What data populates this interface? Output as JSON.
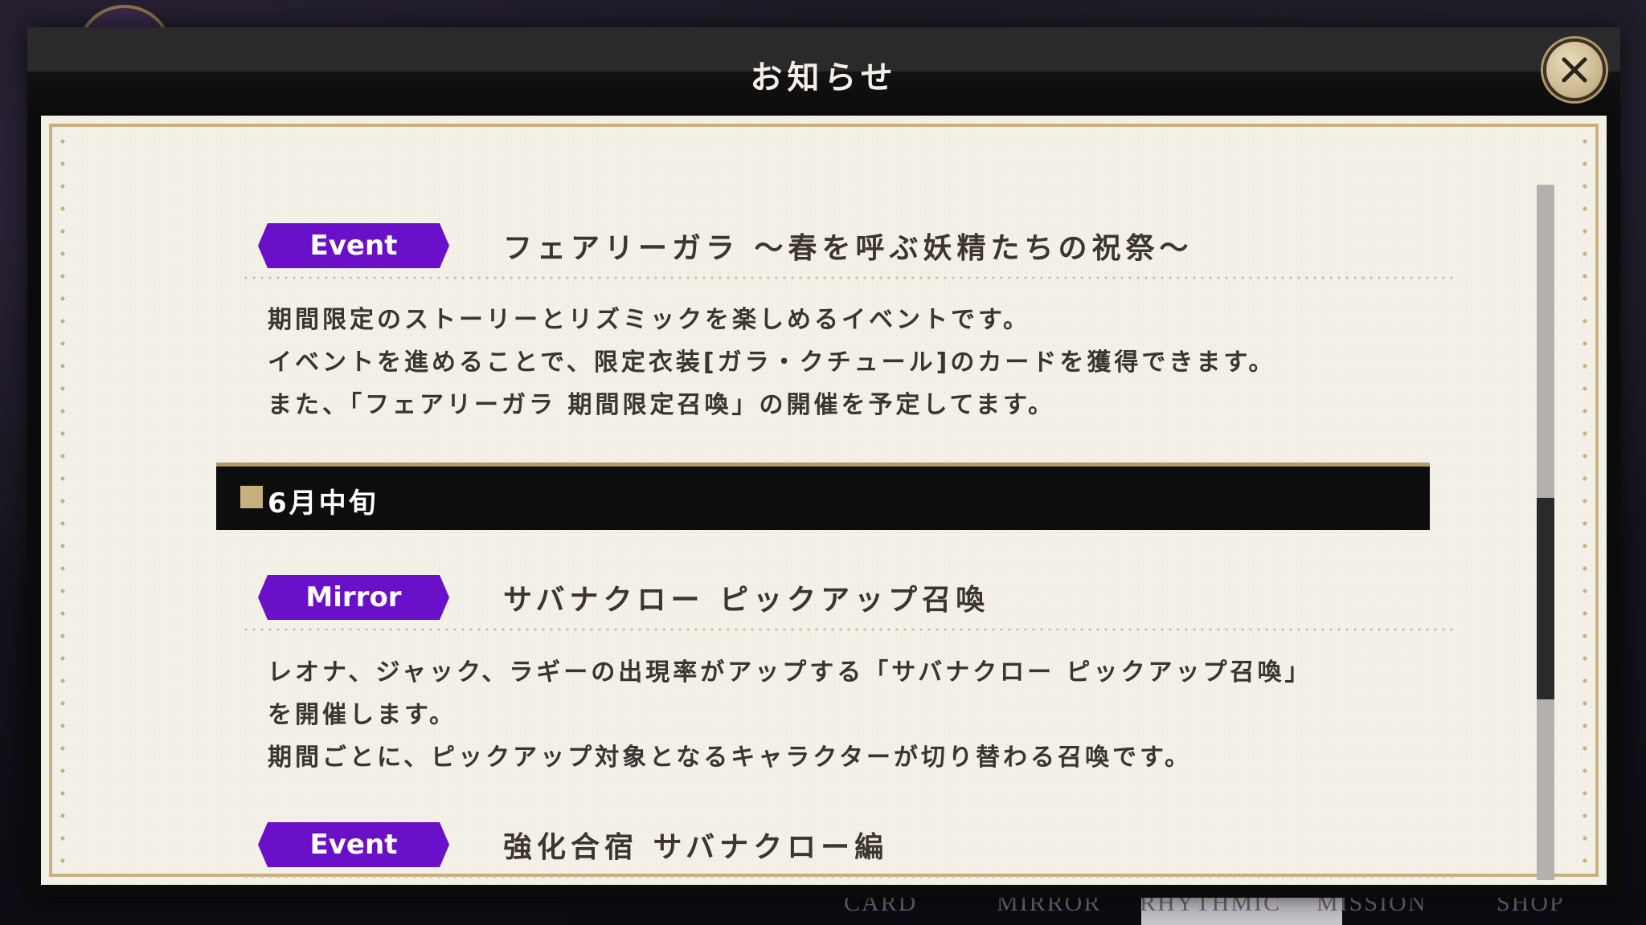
{
  "background": {
    "nav_items": [
      "CARD",
      "MIRROR",
      "RHYTHMIC",
      "MISSION",
      "SHOP"
    ]
  },
  "modal": {
    "title": "お知らせ",
    "close_icon": "close-icon"
  },
  "notices": [
    {
      "tag": "Event",
      "title": "フェアリーガラ ～春を呼ぶ妖精たちの祝祭～",
      "body": [
        "期間限定のストーリーとリズミックを楽しめるイベントです。",
        "イベントを進めることで、限定衣装[ガラ・クチュール]のカードを獲得できます。",
        "また、「フェアリーガラ 期間限定召喚」の開催を予定してます。"
      ]
    },
    {
      "tag": "Mirror",
      "title": "サバナクロー ピックアップ召喚",
      "body": [
        "レオナ、ジャック、ラギーの出現率がアップする「サバナクロー ピックアップ召喚」",
        "を開催します。",
        "期間ごとに、ピックアップ対象となるキャラクターが切り替わる召喚です。"
      ]
    },
    {
      "tag": "Event",
      "title": "強化合宿 サバナクロー編",
      "body": []
    }
  ],
  "section": {
    "date_label": "6月中旬"
  },
  "scroll": {
    "position_fraction": 0.45,
    "visible_fraction": 0.29
  },
  "colors": {
    "tag_purple": "#6a10c8",
    "gold_frame": "#c9b07c",
    "paper": "#f3f0e8"
  }
}
